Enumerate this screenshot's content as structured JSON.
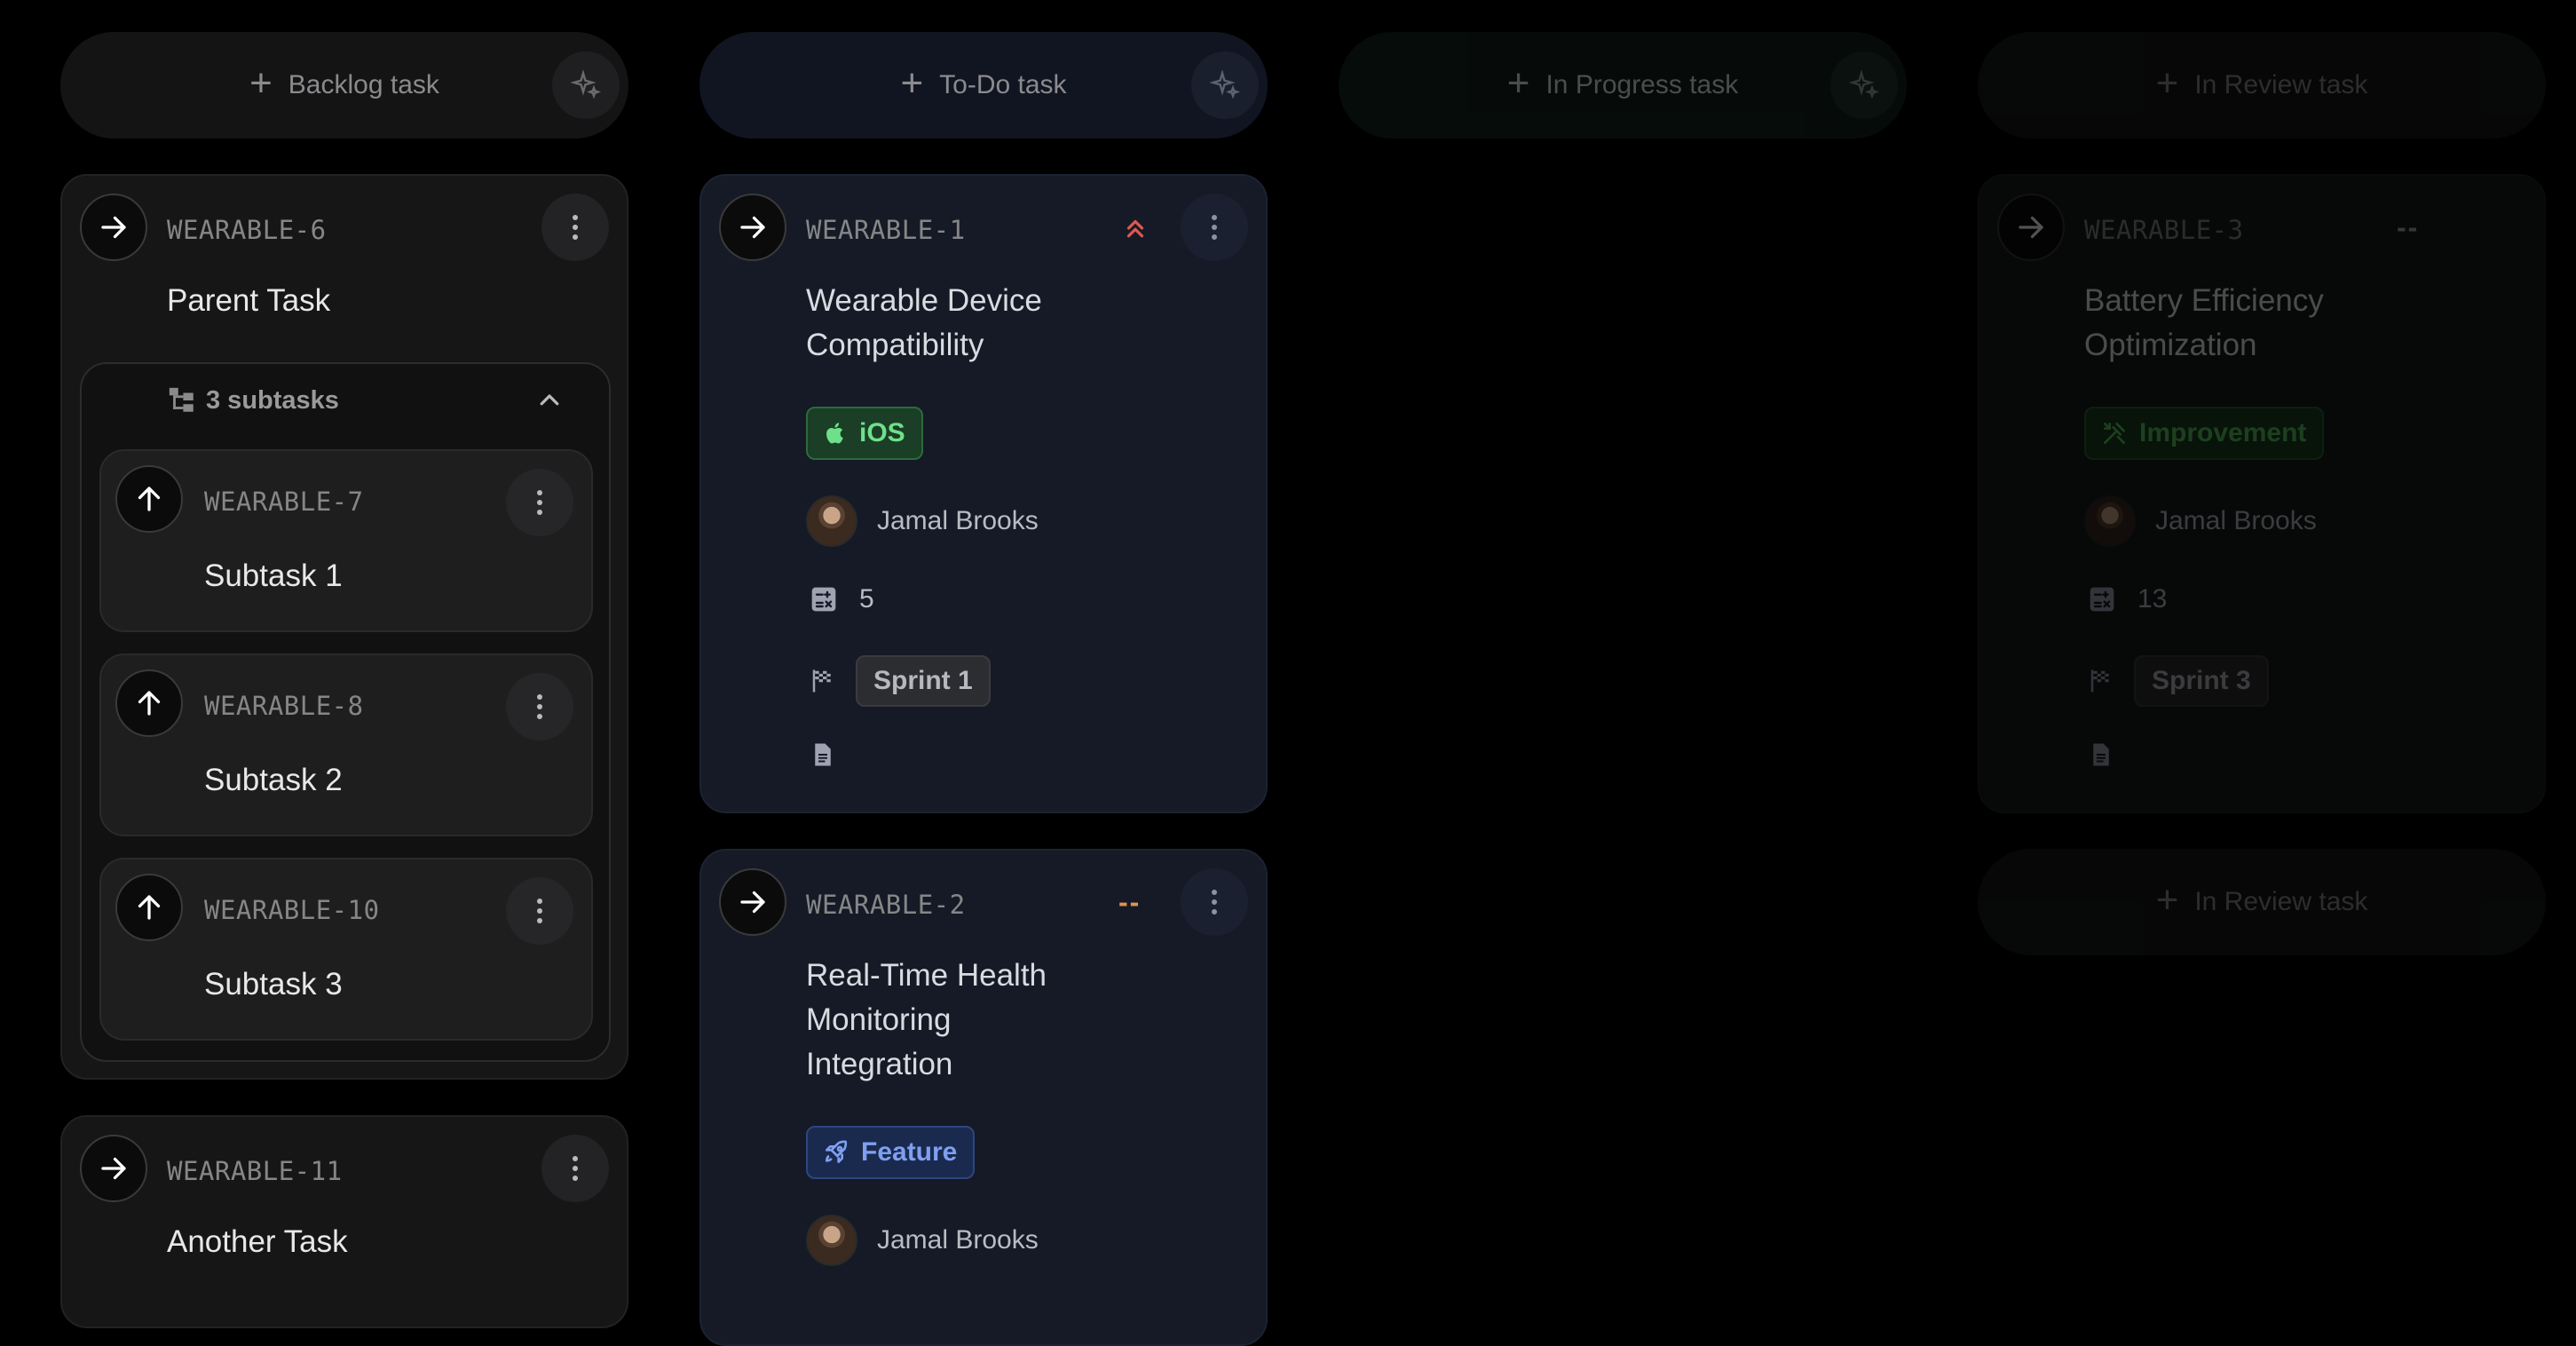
{
  "columns": {
    "backlog": {
      "add_label": "Backlog task"
    },
    "todo": {
      "add_label": "To-Do task"
    },
    "in_progress": {
      "add_label": "In Progress task"
    },
    "in_review": {
      "add_label": "In Review task"
    }
  },
  "backlog_cards": [
    {
      "id": "WEARABLE-6",
      "title": "Parent Task",
      "subtasks_label": "3 subtasks",
      "subtasks": [
        {
          "id": "WEARABLE-7",
          "title": "Subtask 1"
        },
        {
          "id": "WEARABLE-8",
          "title": "Subtask 2"
        },
        {
          "id": "WEARABLE-10",
          "title": "Subtask 3"
        }
      ]
    },
    {
      "id": "WEARABLE-11",
      "title": "Another Task"
    }
  ],
  "todo_cards": [
    {
      "id": "WEARABLE-1",
      "priority_icon": "double-chevron-up-icon",
      "title_line1": "Wearable Device",
      "title_line2": "Compatibility",
      "tag": "iOS",
      "assignee": "Jamal Brooks",
      "points": "5",
      "sprint": "Sprint 1"
    },
    {
      "id": "WEARABLE-2",
      "priority_icon": "double-dash-icon",
      "priority_text": "--",
      "title_line1": "Real-Time Health",
      "title_line2": "Monitoring",
      "title_line3": "Integration",
      "tag": "Feature",
      "assignee": "Jamal Brooks"
    }
  ],
  "review_cards": [
    {
      "id": "WEARABLE-3",
      "priority_text": "--",
      "title_line1": "Battery Efficiency",
      "title_line2": "Optimization",
      "tag": "Improvement",
      "assignee": "Jamal Brooks",
      "points": "13",
      "sprint": "Sprint 3"
    }
  ],
  "colors": {
    "background": "#000000",
    "priority_high": "#e0584e",
    "priority_medium": "#e0924e",
    "ios_tag": "#6ee08a",
    "feature_tag": "#7f9ff0",
    "improvement_tag": "#58c860"
  }
}
